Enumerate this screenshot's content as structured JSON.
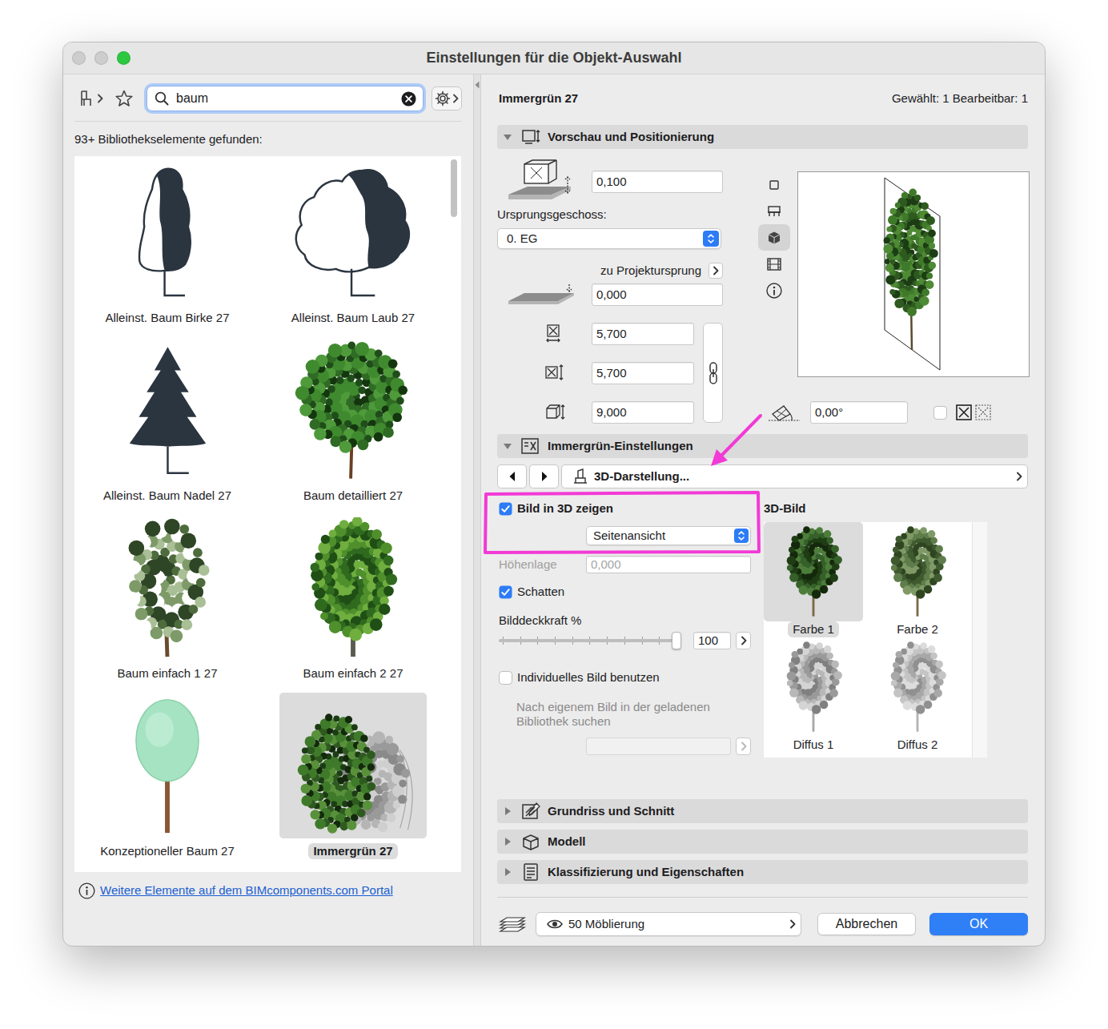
{
  "window": {
    "title": "Einstellungen für die Objekt-Auswahl",
    "controls": [
      {
        "kind": "close",
        "color": "#cdcdcd"
      },
      {
        "kind": "minimize",
        "color": "#cdcdcd"
      },
      {
        "kind": "zoom",
        "color": "#2bc840"
      }
    ]
  },
  "library": {
    "search": {
      "value": "baum"
    },
    "result_count": "93+ Bibliothekselemente gefunden:",
    "items": [
      {
        "label": "Alleinst. Baum Birke 27",
        "kind": "birch",
        "selected": false
      },
      {
        "label": "Alleinst. Baum Laub 27",
        "kind": "leaf",
        "selected": false
      },
      {
        "label": "Alleinst. Baum Nadel 27",
        "kind": "conifer",
        "selected": false
      },
      {
        "label": "Baum detailliert 27",
        "kind": "detailed",
        "selected": false
      },
      {
        "label": "Baum einfach 1 27",
        "kind": "sparse",
        "selected": false
      },
      {
        "label": "Baum einfach 2 27",
        "kind": "dense",
        "selected": false
      },
      {
        "label": "Konzeptioneller Baum 27",
        "kind": "concept",
        "selected": false
      },
      {
        "label": "Immergrün 27",
        "kind": "evergreen",
        "selected": true
      }
    ],
    "portal_link": "Weitere Elemente auf dem BIMcomponents.com Portal"
  },
  "object": {
    "name": "Immergrün 27",
    "selection_info": "Gewählt: 1 Bearbeitbar: 1"
  },
  "preview_section": {
    "title": "Vorschau und Positionierung",
    "expanded": true,
    "elevation": "0,100",
    "home_story_label": "Ursprungsgeschoss:",
    "home_story": "0. EG",
    "reference_label": "zu Projektursprung",
    "reference_elevation": "0,000",
    "width": "5,700",
    "depth": "5,700",
    "height": "9,000",
    "proportions_linked": true,
    "view_modes": [
      {
        "kind": "plan",
        "selected": false
      },
      {
        "kind": "symbol",
        "selected": false
      },
      {
        "kind": "model",
        "selected": true
      },
      {
        "kind": "film",
        "selected": false
      },
      {
        "kind": "info",
        "selected": false
      }
    ],
    "angle": "0,00°",
    "mirrored": false
  },
  "settings_section": {
    "title": "Immergrün-Einstellungen",
    "expanded": true,
    "page": "3D-Darstellung...",
    "show_image": {
      "label": "Bild in 3D zeigen",
      "checked": true
    },
    "view": "Seitenansicht",
    "elevation": {
      "label": "Höhenlage",
      "value": "0,000",
      "disabled": true
    },
    "shadow": {
      "label": "Schatten",
      "checked": true
    },
    "opacity": {
      "label": "Bilddeckkraft %",
      "level": 1,
      "value": "100"
    },
    "custom_image": {
      "label": "Individuelles Bild benutzen",
      "checked": false
    },
    "custom_hint": "Nach eigenem Bild in der geladenen Bibliothek suchen",
    "custom_path": {
      "disabled": true
    },
    "image_title": "3D-Bild",
    "images": [
      {
        "label": "Farbe 1",
        "kind": "color",
        "selected": true
      },
      {
        "label": "Farbe 2",
        "kind": "color",
        "selected": false
      },
      {
        "label": "Diffus 1",
        "kind": "diffuse",
        "selected": false
      },
      {
        "label": "Diffus 2",
        "kind": "diffuse",
        "selected": false
      }
    ]
  },
  "collapsed_sections": [
    {
      "title": "Grundriss und Schnitt",
      "kind": "plan",
      "expanded": false
    },
    {
      "title": "Modell",
      "kind": "model",
      "expanded": false
    },
    {
      "title": "Klassifizierung und Eigenschaften",
      "kind": "classification",
      "expanded": false
    }
  ],
  "footer": {
    "layer": "50 Möblierung",
    "layer_visible": true,
    "buttons": [
      {
        "label": "Abbrechen",
        "primary": false
      },
      {
        "label": "OK",
        "primary": true
      }
    ]
  }
}
